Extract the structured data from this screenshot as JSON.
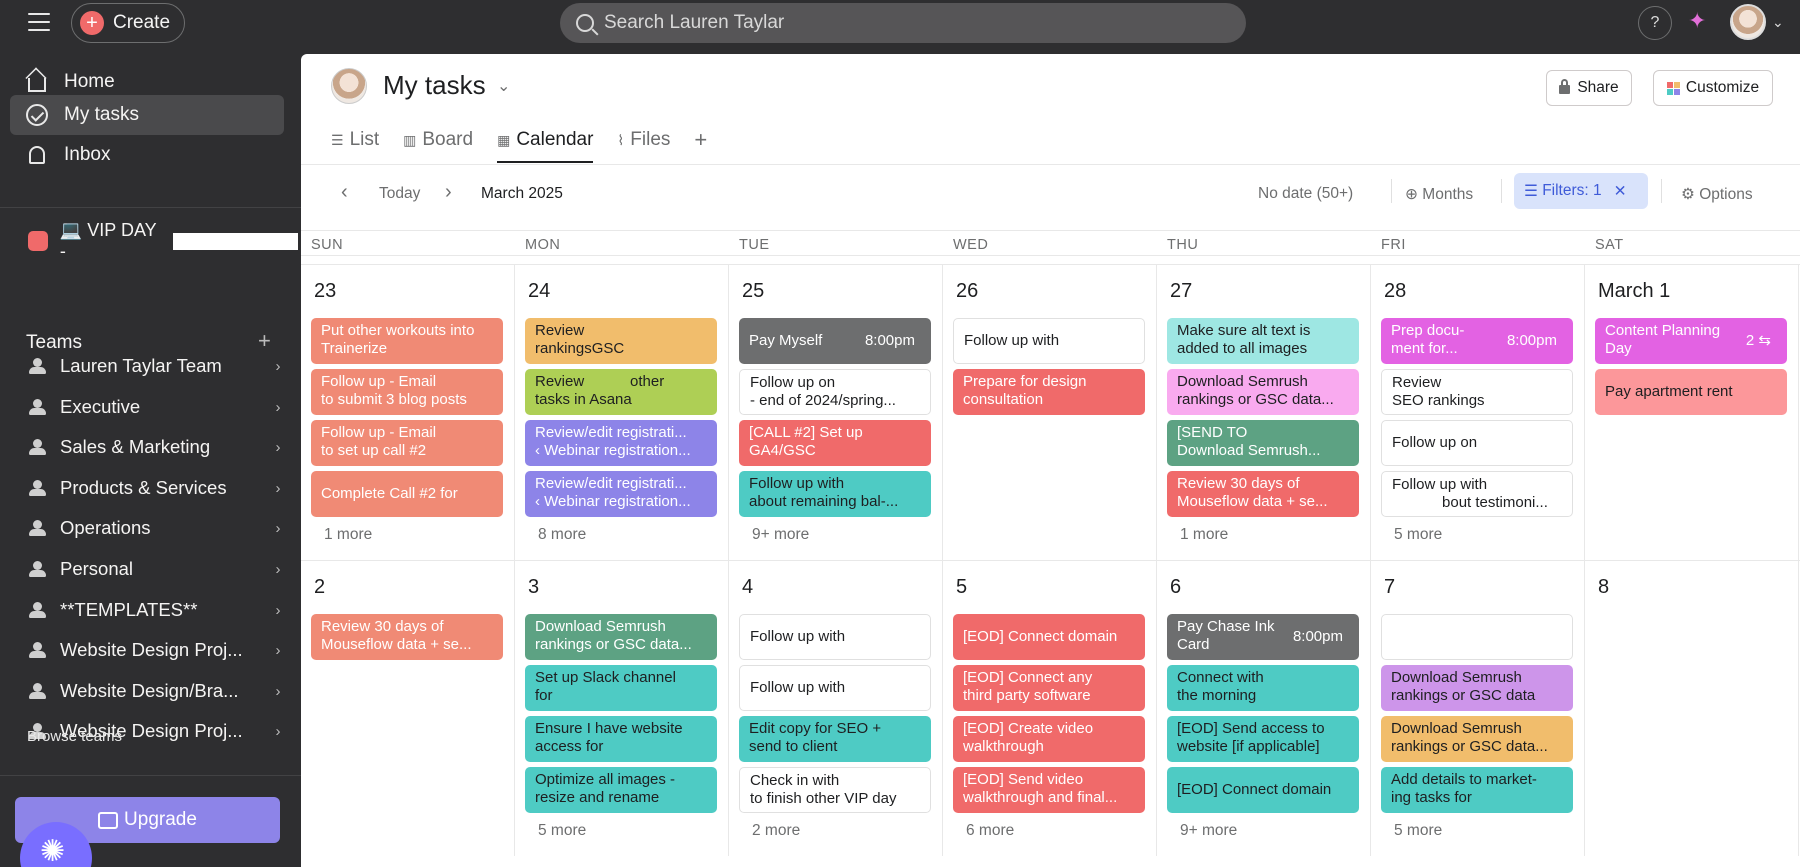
{
  "topbar": {
    "create_label": "Create",
    "search_placeholder": "Search Lauren Taylar",
    "help_label": "?"
  },
  "sidebar": {
    "nav": [
      {
        "label": "Home",
        "icon": "home-icon"
      },
      {
        "label": "My tasks",
        "icon": "check-circle-icon",
        "active": true
      },
      {
        "label": "Inbox",
        "icon": "bell-icon"
      }
    ],
    "project_label": "💻 VIP DAY -",
    "teams_heading": "Teams",
    "teams": [
      "Lauren Taylar Team",
      "Executive",
      "Sales & Marketing",
      "Products & Services",
      "Operations",
      "Personal",
      "**TEMPLATES**",
      "Website Design Proj...",
      "Website Design/Bra...",
      "Website Design Proj..."
    ],
    "browse_teams": "Browse teams",
    "upgrade_label": "Upgrade"
  },
  "header": {
    "title": "My tasks",
    "share_label": "Share",
    "customize_label": "Customize",
    "tabs": [
      {
        "label": "List",
        "icon": "list-icon"
      },
      {
        "label": "Board",
        "icon": "board-icon"
      },
      {
        "label": "Calendar",
        "icon": "calendar-icon",
        "active": true
      },
      {
        "label": "Files",
        "icon": "paperclip-icon"
      }
    ]
  },
  "toolbar": {
    "today_label": "Today",
    "month_label": "March 2025",
    "no_date_label": "No date (50+)",
    "months_label": "Months",
    "filters_label": "Filters: 1",
    "options_label": "Options"
  },
  "calendar": {
    "weekdays": [
      "SUN",
      "MON",
      "TUE",
      "WED",
      "THU",
      "FRI",
      "SAT"
    ],
    "weeks": [
      {
        "days": [
          {
            "num": "23",
            "more": "1 more",
            "cards": [
              {
                "text": "Put other workouts into\nTrainerize",
                "color": "c-salmon"
              },
              {
                "text": "Follow up - Email\nto submit 3 blog posts",
                "color": "c-salmon"
              },
              {
                "text": "Follow up - Email\nto set up call #2",
                "color": "c-salmon"
              },
              {
                "text": "Complete Call #2 for",
                "color": "c-salmon"
              }
            ]
          },
          {
            "num": "24",
            "more": "8 more",
            "cards": [
              {
                "text": "Review\nrankingsGSC",
                "color": "c-orange"
              },
              {
                "text": "Review           other\ntasks in Asana",
                "color": "c-lime"
              },
              {
                "text": "Review/edit registrati...\n‹ Webinar registration...",
                "color": "c-purple"
              },
              {
                "text": "Review/edit registrati...\n‹ Webinar registration...",
                "color": "c-purple"
              }
            ]
          },
          {
            "num": "25",
            "more": "9+ more",
            "cards": [
              {
                "text": "Pay Myself",
                "time": "8:00pm",
                "color": "c-dark"
              },
              {
                "text": "Follow up on\n- end of 2024/spring...",
                "color": "c-white"
              },
              {
                "text": "[CALL #2] Set up\nGA4/GSC",
                "color": "c-red"
              },
              {
                "text": "Follow up with\nabout remaining bal-...",
                "color": "c-teal"
              }
            ]
          },
          {
            "num": "26",
            "more": "",
            "cards": [
              {
                "text": "Follow up with",
                "color": "c-white"
              },
              {
                "text": "Prepare for design\nconsultation",
                "color": "c-red"
              }
            ]
          },
          {
            "num": "27",
            "more": "1 more",
            "cards": [
              {
                "text": "Make sure alt text is\nadded to all images",
                "color": "c-aqua"
              },
              {
                "text": "Download Semrush\nrankings or GSC data...",
                "color": "c-pink"
              },
              {
                "text": "[SEND TO\nDownload Semrush...",
                "color": "c-green"
              },
              {
                "text": "Review 30 days of\nMouseflow data + se...",
                "color": "c-red"
              }
            ]
          },
          {
            "num": "28",
            "more": "5 more",
            "cards": [
              {
                "text": "Prep docu-\nment for...",
                "time": "8:00pm",
                "color": "c-magenta"
              },
              {
                "text": "Review\nSEO rankings",
                "color": "c-white"
              },
              {
                "text": "Follow up on",
                "color": "c-white"
              },
              {
                "text": "Follow up with\n            bout testimoni...",
                "color": "c-white"
              }
            ]
          },
          {
            "num": "March 1",
            "more": "",
            "cards": [
              {
                "text": "Content Planning\nDay",
                "time": "2 ⇆",
                "color": "c-magenta"
              },
              {
                "text": "Pay apartment rent",
                "color": "c-rose"
              }
            ]
          }
        ]
      },
      {
        "days": [
          {
            "num": "2",
            "more": "",
            "cards": [
              {
                "text": "Review 30 days of\nMouseflow data + se...",
                "color": "c-salmon"
              }
            ]
          },
          {
            "num": "3",
            "more": "5 more",
            "cards": [
              {
                "text": "Download Semrush\nrankings or GSC data...",
                "color": "c-green"
              },
              {
                "text": "Set up Slack channel\nfor",
                "color": "c-teal"
              },
              {
                "text": "Ensure I have website\naccess for",
                "color": "c-teal"
              },
              {
                "text": "Optimize all images -\nresize and rename",
                "color": "c-teal"
              }
            ]
          },
          {
            "num": "4",
            "more": "2 more",
            "cards": [
              {
                "text": "Follow up with",
                "color": "c-white"
              },
              {
                "text": "Follow up with",
                "color": "c-white"
              },
              {
                "text": "Edit copy for SEO +\nsend to client",
                "color": "c-teal"
              },
              {
                "text": "Check in with\nto finish other VIP day",
                "color": "c-white"
              }
            ]
          },
          {
            "num": "5",
            "more": "6 more",
            "cards": [
              {
                "text": "[EOD] Connect domain",
                "color": "c-red"
              },
              {
                "text": "[EOD] Connect any\nthird party software",
                "color": "c-red"
              },
              {
                "text": "[EOD] Create video\nwalkthrough",
                "color": "c-red"
              },
              {
                "text": "[EOD] Send video\nwalkthrough and final...",
                "color": "c-red"
              }
            ]
          },
          {
            "num": "6",
            "more": "9+ more",
            "cards": [
              {
                "text": "Pay Chase Ink\nCard",
                "time": "8:00pm",
                "color": "c-dark"
              },
              {
                "text": "Connect with\nthe morning",
                "color": "c-teal"
              },
              {
                "text": "[EOD] Send access to\nwebsite [if applicable]",
                "color": "c-teal"
              },
              {
                "text": "[EOD] Connect domain",
                "color": "c-teal"
              }
            ]
          },
          {
            "num": "7",
            "more": "5 more",
            "cards": [
              {
                "text": "",
                "color": "c-white"
              },
              {
                "text": "Download Semrush\nrankings or GSC data",
                "color": "c-orchid"
              },
              {
                "text": "Download Semrush\nrankings or GSC data...",
                "color": "c-orange"
              },
              {
                "text": "Add details to market-\ning tasks for",
                "color": "c-teal"
              }
            ]
          },
          {
            "num": "8",
            "more": "",
            "cards": []
          }
        ]
      }
    ]
  }
}
